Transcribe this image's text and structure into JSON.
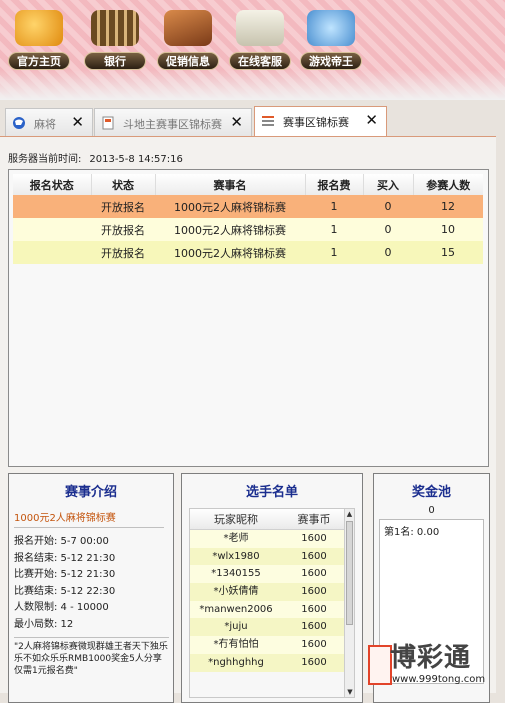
{
  "nav": [
    {
      "label": "官方主页",
      "icon": "home-icon",
      "color": "#f3a31a"
    },
    {
      "label": "银行",
      "icon": "abacus-icon",
      "color": "#6a4a22"
    },
    {
      "label": "促销信息",
      "icon": "book-icon",
      "color": "#b8662e"
    },
    {
      "label": "在线客服",
      "icon": "support-icon",
      "color": "#e0e0d0"
    },
    {
      "label": "游戏帝王",
      "icon": "king-icon",
      "color": "#5aa2dc"
    }
  ],
  "tabs": [
    {
      "label": "麻将",
      "icon": "globe-icon"
    },
    {
      "label": "斗地主赛事区锦标赛",
      "icon": "doc-icon"
    },
    {
      "label": "赛事区锦标赛",
      "icon": "list-icon"
    }
  ],
  "server": {
    "label": "服务器当前时间:",
    "time": "2013-5-8 14:57:16"
  },
  "events": {
    "headers": [
      "报名状态",
      "状态",
      "赛事名",
      "报名费",
      "买入",
      "参赛人数"
    ],
    "rows": [
      [
        "",
        "开放报名",
        "1000元2人麻将锦标赛",
        "1",
        "0",
        "12"
      ],
      [
        "",
        "开放报名",
        "1000元2人麻将锦标赛",
        "1",
        "0",
        "10"
      ],
      [
        "",
        "开放报名",
        "1000元2人麻将锦标赛",
        "1",
        "0",
        "15"
      ]
    ]
  },
  "intro": {
    "title": "赛事介绍",
    "name": "1000元2人麻将锦标赛",
    "rows": [
      "报名开始: 5-7 00:00",
      "报名结束: 5-12 21:30",
      "比赛开始: 5-12 21:30",
      "比赛结束: 5-12 22:30",
      "人数限制: 4 - 10000",
      "最小局数: 12"
    ],
    "desc": "\"2人麻将锦标赛微现群雄王者天下独乐乐不如众乐乐RMB1000奖金5人分享仅需1元报名费\""
  },
  "players": {
    "title": "选手名单",
    "headers": [
      "玩家昵称",
      "赛事币"
    ],
    "rows": [
      [
        "*老师",
        "1600"
      ],
      [
        "*wlx1980",
        "1600"
      ],
      [
        "*1340155",
        "1600"
      ],
      [
        "*小妖倩倩",
        "1600"
      ],
      [
        "*manwen2006",
        "1600"
      ],
      [
        "*juju",
        "1600"
      ],
      [
        "*冇有怕怕",
        "1600"
      ],
      [
        "*nghhghhg",
        "1600"
      ]
    ]
  },
  "prize": {
    "title": "奖金池",
    "count": "0",
    "first": "第1名: 0.00"
  },
  "watermark": {
    "brand": "博彩通",
    "url": "www.999tong.com"
  }
}
